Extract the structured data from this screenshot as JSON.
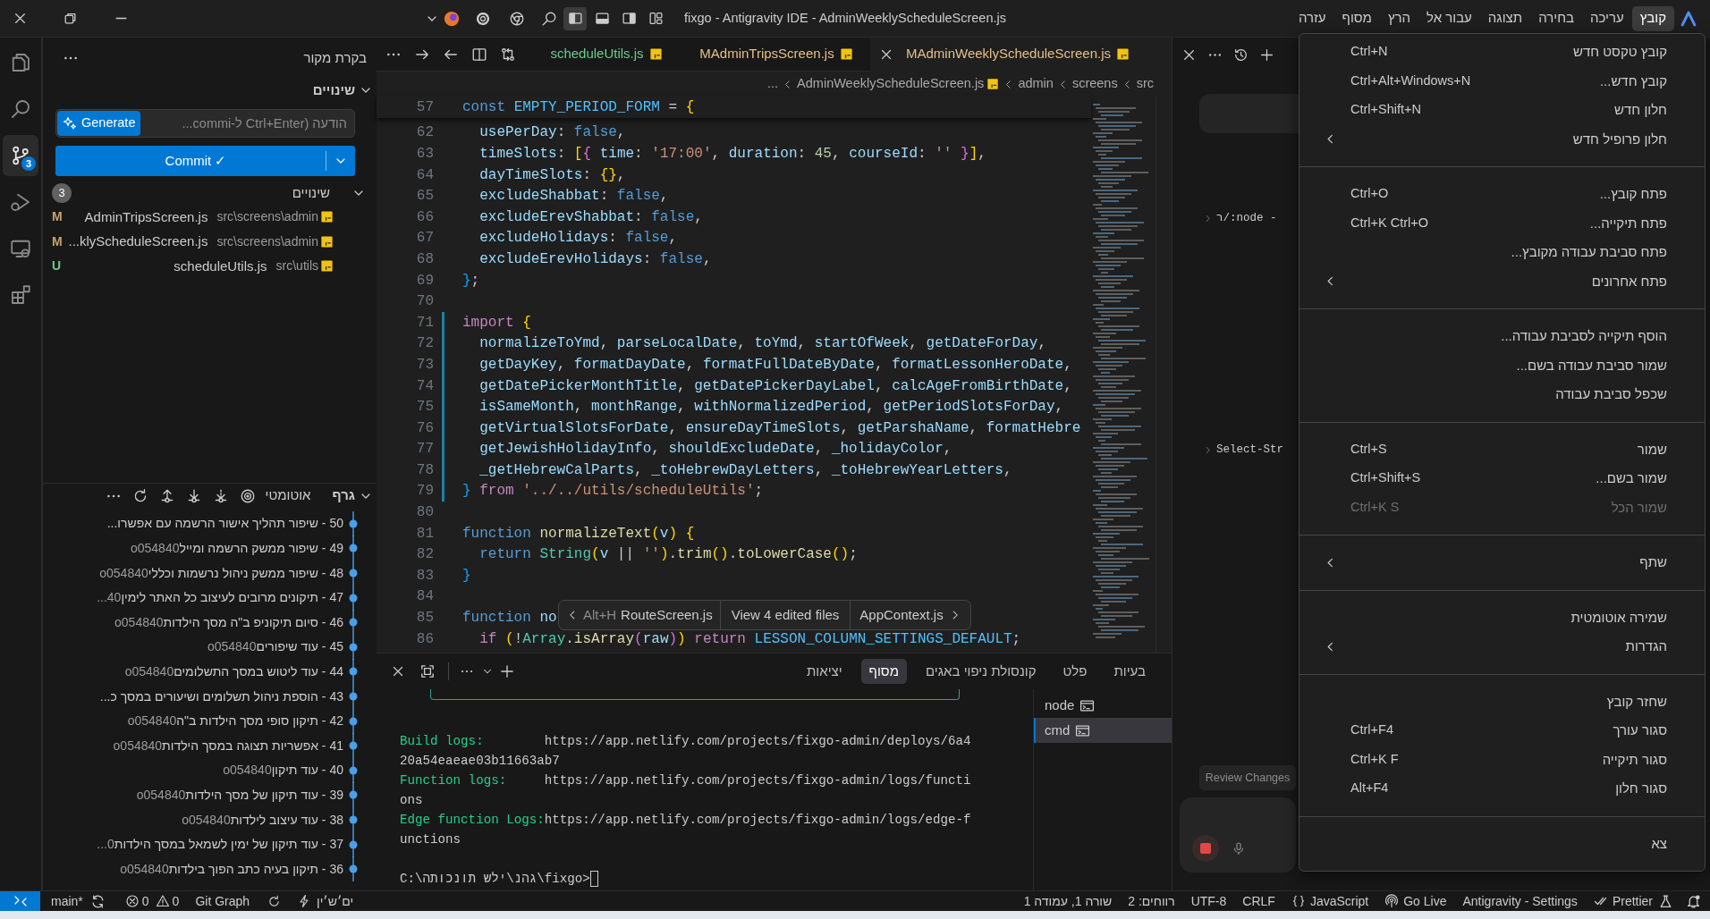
{
  "title_bar": {
    "title": "fixgo - Antigravity IDE - AdminWeeklyScheduleScreen.js",
    "menus": [
      {
        "label": "קובץ",
        "selected": true
      },
      {
        "label": "עריכה",
        "selected": false
      },
      {
        "label": "בחירה",
        "selected": false
      },
      {
        "label": "תצוגה",
        "selected": false
      },
      {
        "label": "עבור אל",
        "selected": false
      },
      {
        "label": "הרץ",
        "selected": false
      },
      {
        "label": "מסוף",
        "selected": false
      },
      {
        "label": "עזרה",
        "selected": false
      }
    ]
  },
  "activity_bar": [
    {
      "kind": "files",
      "selected": false
    },
    {
      "kind": "search",
      "selected": false
    },
    {
      "kind": "source-control",
      "selected": true,
      "badge": "3"
    },
    {
      "kind": "debug",
      "selected": false
    },
    {
      "kind": "remote",
      "selected": false
    },
    {
      "kind": "extensions",
      "selected": false
    }
  ],
  "source_control": {
    "title": "בקרת מקור",
    "section": "שינויים",
    "generate": "Generate",
    "message": {
      "placeholder": "הודעה (Ctrl+Enter ל-commi..."
    },
    "commit": "Commit ✓",
    "changes": {
      "title": "שינויים",
      "count": "3",
      "files": [
        {
          "kind": "modified",
          "status": "M",
          "name": "AdminTripsScreen.js",
          "path": "src\\screens\\admin"
        },
        {
          "kind": "modified",
          "status": "M",
          "name": "...klyScheduleScreen.js",
          "path": "src\\screens\\admin"
        },
        {
          "kind": "untracked",
          "status": "U",
          "name": "scheduleUtils.js",
          "path": "src\\utils"
        }
      ]
    }
  },
  "graph": {
    "title": "גרף",
    "mode": "אוטומטי",
    "commits": [
      {
        "text": "50 - שיפור תהליך אישור הרשמה עם אפשרו..."
      },
      {
        "text": "49 - שיפור ממשק הרשמה ומייל",
        "author": "o054840"
      },
      {
        "text": "48 - שיפור ממשק ניהול נרשמות וכללי",
        "author": "o054840"
      },
      {
        "text": "47 - תיקונים מרובים לעיצוב כל האתר לימין",
        "author": "...40"
      },
      {
        "text": "46 - סיום תיקוניפ ב\"ה מסך הילדות",
        "author": "o054840"
      },
      {
        "text": "45 - עוד שיפורים",
        "author": "o054840"
      },
      {
        "text": "44 - עוד ליטוש במסך התשלומים",
        "author": "o054840"
      },
      {
        "text": "43 - הוספת ניהול תשלומים ושיעורים במסך כ..."
      },
      {
        "text": "42 - תיקון סופי מסך הילדות ב\"ה",
        "author": "o054840"
      },
      {
        "text": "41 - אפשריות תצוגה במסך הילדות",
        "author": "o054840"
      },
      {
        "text": "40 - עוד תיקון",
        "author": "o054840"
      },
      {
        "text": "39 - עוד תיקון של מסך הילדות",
        "author": "o054840"
      },
      {
        "text": "38 - עוד עיצוב לילדות",
        "author": "o054840"
      },
      {
        "text": "37 - עוד תיקון של ימין לשמאל במסך הילדות",
        "author": "...0"
      },
      {
        "text": "36 - תיקון בעיה כתב הפוך בילדות",
        "author": "o054840"
      }
    ]
  },
  "editor": {
    "tabs": [
      {
        "label": "MAdminWeeklyScheduleScreen.js",
        "kind": "modified",
        "selected": true
      },
      {
        "label": "MAdminTripsScreen.js",
        "kind": "modified",
        "selected": false
      },
      {
        "label": "scheduleUtils.js",
        "kind": "untracked",
        "selected": false
      }
    ],
    "breadcrumbs": [
      "src",
      "screens",
      "admin",
      "AdminWeeklyScheduleScreen.js",
      "..."
    ],
    "sticky_line": {
      "number": "57",
      "text": "const EMPTY_PERIOD_FORM = {"
    },
    "lines": [
      {
        "number": "62",
        "modified": false,
        "text": "  usePerDay: false,"
      },
      {
        "number": "63",
        "modified": false,
        "text": "  timeSlots: [{ time: '17:00', duration: 45, courseId: '' }],"
      },
      {
        "number": "64",
        "modified": false,
        "text": "  dayTimeSlots: {},"
      },
      {
        "number": "65",
        "modified": false,
        "text": "  excludeShabbat: false,"
      },
      {
        "number": "66",
        "modified": false,
        "text": "  excludeErevShabbat: false,"
      },
      {
        "number": "67",
        "modified": false,
        "text": "  excludeHolidays: false,"
      },
      {
        "number": "68",
        "modified": false,
        "text": "  excludeErevHolidays: false,"
      },
      {
        "number": "69",
        "modified": false,
        "text": "};"
      },
      {
        "number": "70",
        "modified": false
      },
      {
        "number": "71",
        "modified": true,
        "text": "import {"
      },
      {
        "number": "72",
        "modified": true,
        "text": "  normalizeToYmd, parseLocalDate, toYmd, startOfWeek, getDateForDay,"
      },
      {
        "number": "73",
        "modified": true,
        "text": "  getDayKey, formatDayDate, formatFullDateByDate, formatLessonHeroDate,"
      },
      {
        "number": "74",
        "modified": true,
        "text": "  getDatePickerMonthTitle, getDatePickerDayLabel, calcAgeFromBirthDate,"
      },
      {
        "number": "75",
        "modified": true,
        "text": "  isSameMonth, monthRange, withNormalizedPeriod, getPeriodSlotsForDay,"
      },
      {
        "number": "76",
        "modified": true,
        "text": "  getVirtualSlotsForDate, ensureDayTimeSlots, getParshaName, formatHebre"
      },
      {
        "number": "77",
        "modified": true,
        "text": "  getJewishHolidayInfo, shouldExcludeDate, _holidayColor,"
      },
      {
        "number": "78",
        "modified": true,
        "text": "  _getHebrewCalParts, _toHebrewDayLetters, _toHebrewYearLetters,"
      },
      {
        "number": "79",
        "modified": true,
        "text": "} from '../../utils/scheduleUtils';"
      },
      {
        "number": "80",
        "modified": false
      },
      {
        "number": "81",
        "modified": false,
        "text": "function normalizeText(v) {"
      },
      {
        "number": "82",
        "modified": false,
        "text": "  return String(v || '').trim().toLowerCase();"
      },
      {
        "number": "83",
        "modified": false,
        "text": "}"
      },
      {
        "number": "84",
        "modified": false
      },
      {
        "number": "85",
        "modified": false,
        "text": "function no"
      },
      {
        "number": "86",
        "modified": false,
        "text": "  if (!Array.isArray(raw)) return LESSON_COLUMN_SETTINGS_DEFAULT;"
      }
    ],
    "hover_bar": {
      "shortcut": "Alt+H",
      "previous": "RouteScreen.js",
      "middle": "View 4 edited files",
      "next": "AppContext.js"
    }
  },
  "terminal": {
    "tabs": [
      {
        "label": "בעיות",
        "selected": false
      },
      {
        "label": "פלט",
        "selected": false
      },
      {
        "label": "קונסולת ניפוי באגים",
        "selected": false
      },
      {
        "label": "מסוף",
        "selected": true
      },
      {
        "label": "יציאות",
        "selected": false
      }
    ],
    "lines": [
      {
        "label": "Build logs:",
        "text": "https://app.netlify.com/projects/fixgo-admin/deploys/6a4"
      },
      {
        "text": "20a54eaeae03b11663ab7"
      },
      {
        "label": "Function logs:",
        "text": "https://app.netlify.com/projects/fixgo-admin/logs/functi"
      },
      {
        "text": "ons"
      },
      {
        "label": "Edge function Logs:",
        "text": "https://app.netlify.com/projects/fixgo-admin/logs/edge-f"
      },
      {
        "text": "unctions"
      }
    ],
    "prompt": "C:\\התוכנות שלי\\נהג\\fixgo>",
    "sessions": [
      {
        "label": "node",
        "selected": false
      },
      {
        "label": "cmd",
        "selected": true
      }
    ]
  },
  "agent_panel": {
    "lines": [
      "ר/:node -",
      "Select-Str"
    ],
    "review_button": "Review Changes"
  },
  "file_menu": {
    "groups": [
      {
        "items": [
          {
            "label": "קובץ טקסט חדש",
            "shortcut": "Ctrl+N",
            "disabled": false,
            "submenu": false
          },
          {
            "label": "קובץ חדש...",
            "shortcut": "Ctrl+Alt+Windows+N",
            "disabled": false,
            "submenu": false
          },
          {
            "label": "חלון חדש",
            "shortcut": "Ctrl+Shift+N",
            "disabled": false,
            "submenu": false
          },
          {
            "label": "חלון פרופיל חדש",
            "disabled": false,
            "submenu": true
          }
        ]
      },
      {
        "items": [
          {
            "label": "פתח קובץ...",
            "shortcut": "Ctrl+O",
            "disabled": false,
            "submenu": false
          },
          {
            "label": "פתח תיקייה...",
            "shortcut": "Ctrl+K Ctrl+O",
            "disabled": false,
            "submenu": false
          },
          {
            "label": "פתח סביבת עבודה מקובץ...",
            "disabled": false,
            "submenu": false
          },
          {
            "label": "פתח אחרונים",
            "disabled": false,
            "submenu": true
          }
        ]
      },
      {
        "items": [
          {
            "label": "הוסף תיקייה לסביבת עבודה...",
            "disabled": false,
            "submenu": false
          },
          {
            "label": "שמור סביבת עבודה בשם...",
            "disabled": false,
            "submenu": false
          },
          {
            "label": "שכפל סביבת עבודה",
            "disabled": false,
            "submenu": false
          }
        ]
      },
      {
        "items": [
          {
            "label": "שמור",
            "shortcut": "Ctrl+S",
            "disabled": false,
            "submenu": false
          },
          {
            "label": "שמור בשם...",
            "shortcut": "Ctrl+Shift+S",
            "disabled": false,
            "submenu": false
          },
          {
            "label": "שמור הכל",
            "shortcut": "Ctrl+K S",
            "disabled": true,
            "submenu": false
          }
        ]
      },
      {
        "items": [
          {
            "label": "שתף",
            "disabled": false,
            "submenu": true
          }
        ]
      },
      {
        "items": [
          {
            "label": "שמירה אוטומטית",
            "disabled": false,
            "submenu": false
          },
          {
            "label": "הגדרות",
            "disabled": false,
            "submenu": true
          }
        ]
      },
      {
        "items": [
          {
            "label": "שחזר קובץ",
            "disabled": false,
            "submenu": false
          },
          {
            "label": "סגור עורך",
            "shortcut": "Ctrl+F4",
            "disabled": false,
            "submenu": false
          },
          {
            "label": "סגור תיקייה",
            "shortcut": "Ctrl+K F",
            "disabled": false,
            "submenu": false
          },
          {
            "label": "סגור חלון",
            "shortcut": "Alt+F4",
            "disabled": false,
            "submenu": false
          }
        ]
      },
      {
        "items": [
          {
            "label": "צא",
            "disabled": false,
            "submenu": false
          }
        ]
      }
    ]
  },
  "status_bar": {
    "branch": "main*",
    "errors": "0",
    "warnings": "0",
    "git_graph": "Git Graph",
    "encoding_glitch": "ים׳ש׳ין",
    "right_items": [
      {
        "kind": "prettier",
        "label": "Prettier"
      },
      {
        "kind": "text",
        "label": "Antigravity - Settings"
      },
      {
        "kind": "live",
        "label": "Go Live"
      },
      {
        "kind": "language",
        "label": "JavaScript"
      },
      {
        "kind": "text",
        "label": "CRLF"
      },
      {
        "kind": "text",
        "label": "UTF-8"
      },
      {
        "kind": "text",
        "label": "רווחים: 2"
      },
      {
        "kind": "text",
        "label": "שורה 1, עמודה 1"
      }
    ]
  }
}
